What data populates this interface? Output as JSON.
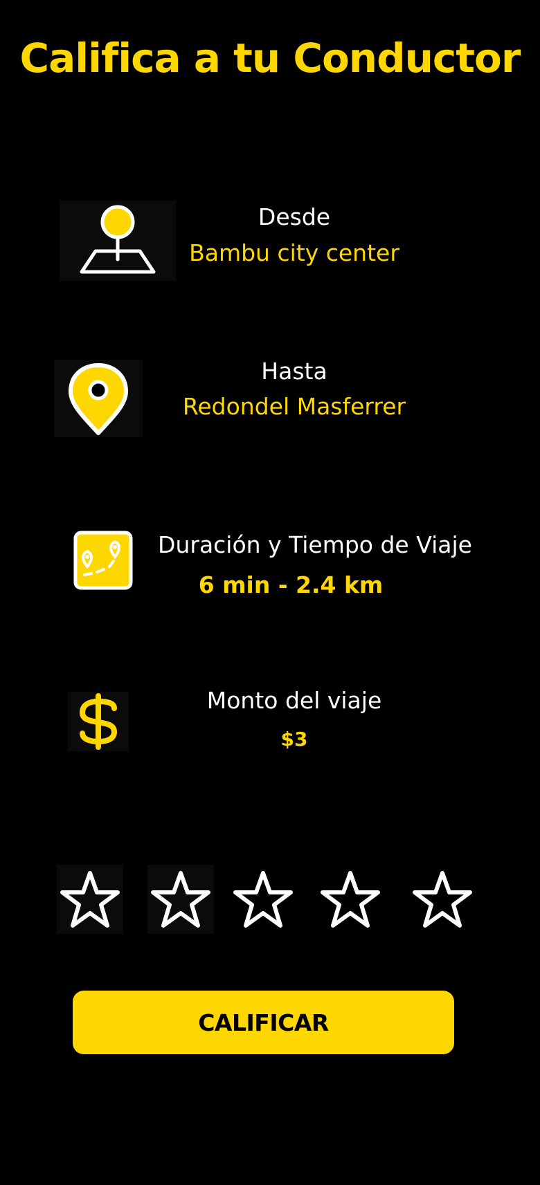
{
  "header": {
    "title": "Califica a tu Conductor"
  },
  "trip": {
    "from": {
      "label": "Desde",
      "value": "Bambu city center",
      "icon": "map-pin-origin-icon"
    },
    "to": {
      "label": "Hasta",
      "value": "Redondel Masferrer",
      "icon": "location-marker-icon"
    },
    "duration": {
      "label": "Duración y Tiempo de Viaje",
      "value": "6 min - 2.4 km",
      "icon": "route-map-icon"
    },
    "amount": {
      "label": "Monto del viaje",
      "value": "$3",
      "icon": "dollar-icon"
    }
  },
  "rating": {
    "max_stars": 5,
    "selected": 0,
    "icon": "star-outline-icon"
  },
  "actions": {
    "submit_label": "CALIFICAR"
  },
  "colors": {
    "background": "#000000",
    "accent": "#FFD700",
    "text": "#FFFFFF"
  }
}
